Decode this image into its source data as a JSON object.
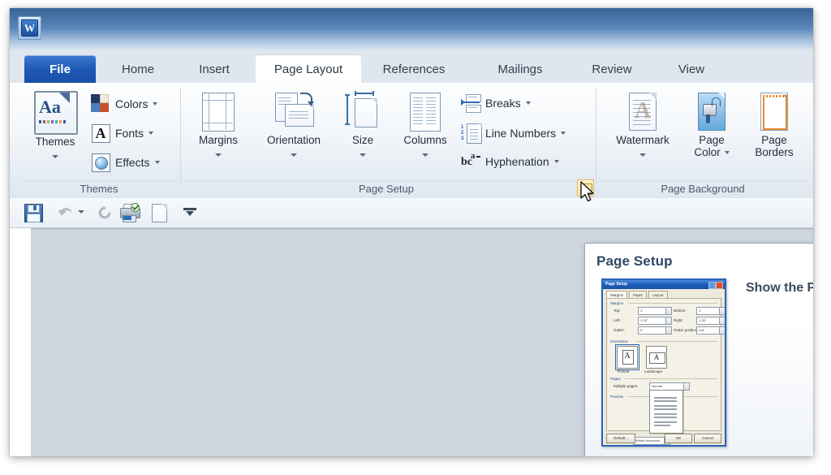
{
  "app": {
    "logo_glyph": "W",
    "titlebar_color": "#2d5d96"
  },
  "tabs": [
    {
      "id": "file",
      "label": "File",
      "state": "file"
    },
    {
      "id": "home",
      "label": "Home",
      "state": "inactive"
    },
    {
      "id": "insert",
      "label": "Insert",
      "state": "inactive"
    },
    {
      "id": "page-layout",
      "label": "Page Layout",
      "state": "active"
    },
    {
      "id": "references",
      "label": "References",
      "state": "inactive"
    },
    {
      "id": "mailings",
      "label": "Mailings",
      "state": "inactive"
    },
    {
      "id": "review",
      "label": "Review",
      "state": "inactive"
    },
    {
      "id": "view",
      "label": "View",
      "state": "inactive"
    }
  ],
  "ribbon": {
    "groups": [
      {
        "id": "themes",
        "label": "Themes",
        "big_buttons": [
          {
            "id": "themes",
            "label": "Themes",
            "has_caret": true
          }
        ],
        "small_buttons": [
          {
            "id": "colors",
            "label": "Colors",
            "has_caret": true
          },
          {
            "id": "fonts",
            "label": "Fonts",
            "has_caret": true
          },
          {
            "id": "effects",
            "label": "Effects",
            "has_caret": true
          }
        ]
      },
      {
        "id": "page-setup",
        "label": "Page Setup",
        "has_launcher": true,
        "launcher_state": "hover",
        "big_buttons": [
          {
            "id": "margins",
            "label": "Margins",
            "has_caret": true
          },
          {
            "id": "orientation",
            "label": "Orientation",
            "has_caret": true
          },
          {
            "id": "size",
            "label": "Size",
            "has_caret": true
          },
          {
            "id": "columns",
            "label": "Columns",
            "has_caret": true
          }
        ],
        "small_buttons": [
          {
            "id": "breaks",
            "label": "Breaks",
            "has_caret": true
          },
          {
            "id": "line-numbers",
            "label": "Line Numbers",
            "has_caret": true
          },
          {
            "id": "hyphenation",
            "label": "Hyphenation",
            "has_caret": true
          }
        ]
      },
      {
        "id": "page-background",
        "label": "Page Background",
        "big_buttons": [
          {
            "id": "watermark",
            "label": "Watermark",
            "has_caret": true
          },
          {
            "id": "page-color",
            "label": "Page\nColor",
            "has_caret": true
          },
          {
            "id": "page-borders",
            "label": "Page\nBorders",
            "has_caret": false
          }
        ],
        "small_buttons": []
      }
    ]
  },
  "quick_access_toolbar": {
    "items": [
      {
        "id": "save",
        "icon": "save-icon",
        "label": "Save",
        "enabled": true
      },
      {
        "id": "undo",
        "icon": "undo-icon",
        "label": "Undo",
        "enabled": false,
        "has_caret": true
      },
      {
        "id": "redo",
        "icon": "redo-icon",
        "label": "Redo",
        "enabled": false
      },
      {
        "id": "print-preview",
        "icon": "print-preview-icon",
        "label": "Print Preview and Print",
        "enabled": true
      },
      {
        "id": "new",
        "icon": "new-document-icon",
        "label": "New",
        "enabled": true
      },
      {
        "id": "customize",
        "icon": "chevron-down-icon",
        "label": "Customize Quick Access Toolbar",
        "enabled": true
      }
    ]
  },
  "tooltip": {
    "title": "Page Setup",
    "description": "Show the P",
    "preview": {
      "window_title": "Page Setup",
      "tabs": [
        "Margins",
        "Paper",
        "Layout"
      ],
      "sections": {
        "margins": {
          "label": "Margins",
          "fields": [
            {
              "label": "Top:",
              "value": "1\""
            },
            {
              "label": "Bottom:",
              "value": "1\""
            },
            {
              "label": "Left:",
              "value": "1.25\""
            },
            {
              "label": "Right:",
              "value": "1.25\""
            },
            {
              "label": "Gutter:",
              "value": "0\""
            },
            {
              "label": "Gutter position:",
              "value": "Left"
            }
          ]
        },
        "orientation": {
          "label": "Orientation",
          "options": [
            "Portrait",
            "Landscape"
          ],
          "selected": "Portrait"
        },
        "pages": {
          "label": "Pages",
          "field_label": "Multiple pages:",
          "value": "Normal"
        },
        "preview": {
          "label": "Preview"
        },
        "apply_to": {
          "label": "Apply to:",
          "value": "Whole document"
        }
      },
      "buttons": [
        {
          "id": "default",
          "label": "Default..."
        },
        {
          "id": "ok",
          "label": "OK"
        },
        {
          "id": "cancel",
          "label": "Cancel"
        }
      ]
    }
  },
  "document": {
    "content": ""
  }
}
